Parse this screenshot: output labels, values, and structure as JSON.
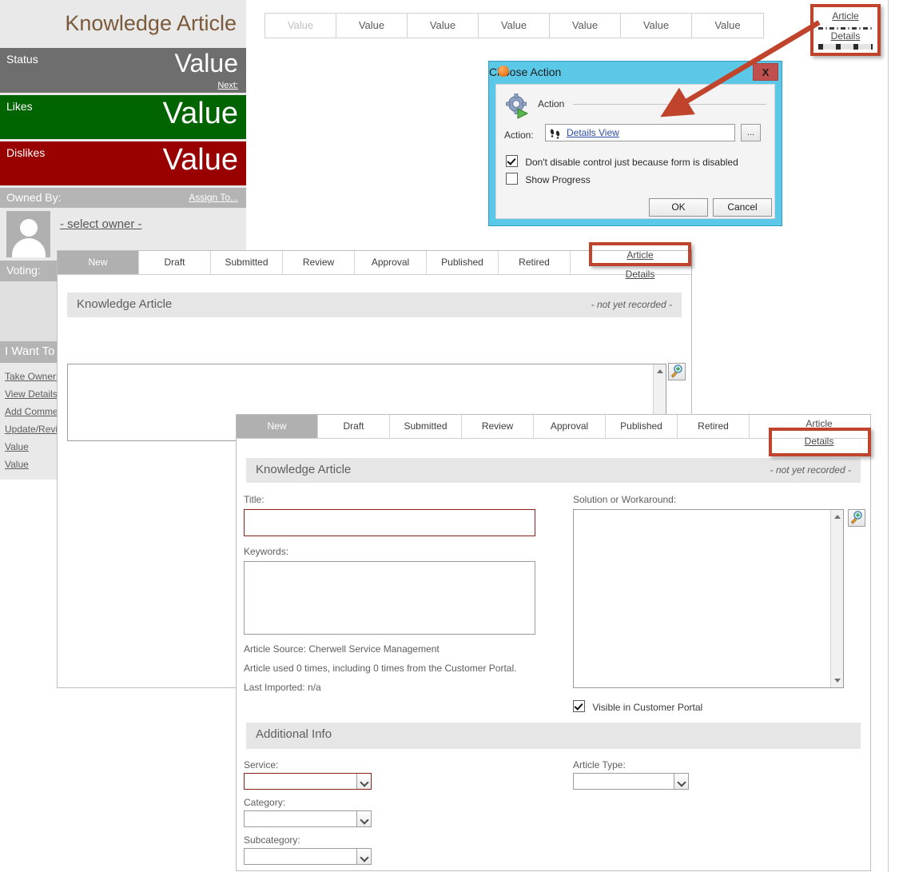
{
  "sidebar": {
    "title": "Knowledge Article",
    "status": {
      "label": "Status",
      "value": "Value",
      "next_link": "Next:"
    },
    "likes": {
      "label": "Likes",
      "value": "Value"
    },
    "dislikes": {
      "label": "Dislikes",
      "value": "Value"
    },
    "owned_by": {
      "label": "Owned By:",
      "assign_link": "Assign To...",
      "owner": "- select owner -"
    },
    "voting": {
      "label": "Voting:"
    },
    "i_want_to": {
      "label": "I Want To",
      "items": [
        "Take Ownership",
        "View Details",
        "Add Comment",
        "Update/Review",
        "Value",
        "Value"
      ]
    }
  },
  "value_strip": {
    "cells": [
      "Value",
      "Value",
      "Value",
      "Value",
      "Value",
      "Value",
      "Value"
    ]
  },
  "callout_top_right": {
    "article_label": "Article",
    "details_label": "Details"
  },
  "dialog": {
    "title": "Choose Action",
    "close_label": "X",
    "group_label": "Action",
    "action_field_label": "Action:",
    "action_value": "Details View",
    "ellipsis_label": "...",
    "checkbox_disable": {
      "label": "Don't disable control just because form is disabled",
      "checked": true
    },
    "checkbox_progress": {
      "label": "Show Progress",
      "checked": false
    },
    "ok_label": "OK",
    "cancel_label": "Cancel"
  },
  "window_article": {
    "tabs": [
      "New",
      "Draft",
      "Submitted",
      "Review",
      "Approval",
      "Published",
      "Retired"
    ],
    "active_tab": "New",
    "side_article_label": "Article",
    "side_details_label": "Details",
    "section_title": "Knowledge Article",
    "section_note": "- not yet recorded -"
  },
  "window_details": {
    "tabs": [
      "New",
      "Draft",
      "Submitted",
      "Review",
      "Approval",
      "Published",
      "Retired"
    ],
    "active_tab": "New",
    "side_article_label": "Article",
    "side_details_label": "Details",
    "section_title": "Knowledge Article",
    "section_note": "- not yet recorded -",
    "fields": {
      "title_label": "Title:",
      "title_value": "",
      "keywords_label": "Keywords:",
      "keywords_value": "",
      "article_source": "Article Source:  Cherwell Service Management",
      "article_used": "Article used 0 times, including 0 times from the Customer Portal.",
      "last_imported": "Last Imported:  n/a",
      "solution_label": "Solution or Workaround:",
      "solution_value": "",
      "visible_portal": {
        "label": "Visible in Customer Portal",
        "checked": true
      }
    },
    "additional_info": {
      "title": "Additional Info",
      "service_label": "Service:",
      "service_value": "",
      "category_label": "Category:",
      "category_value": "",
      "subcategory_label": "Subcategory:",
      "subcategory_value": "",
      "article_type_label": "Article Type:",
      "article_type_value": ""
    }
  },
  "colors": {
    "status_band": "#6e6e6e",
    "likes_band": "#006400",
    "dislikes_band": "#990000",
    "callout_red": "#c0432c",
    "dialog_blue": "#5bc8e8",
    "accent_brown": "#7a5a3a",
    "required_red": "#8a2020"
  }
}
